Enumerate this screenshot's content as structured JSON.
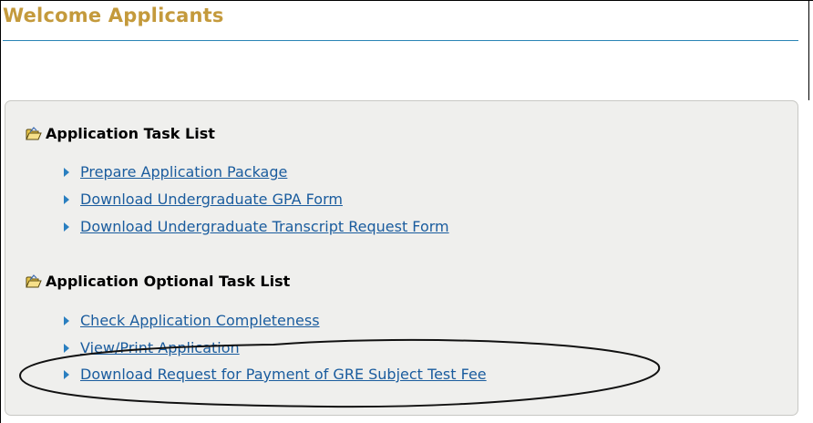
{
  "header": {
    "title": "Welcome Applicants"
  },
  "colors": {
    "title": "#c49a3c",
    "rule": "#2a84b5",
    "link": "#1a5c9e",
    "panel_bg": "#efefed"
  },
  "sections": [
    {
      "heading": "Application Task List",
      "icon": "open-folder-icon",
      "items": [
        {
          "label": "Prepare Application Package",
          "icon": "arrow-right-icon"
        },
        {
          "label": "Download Undergraduate GPA Form",
          "icon": "arrow-right-icon"
        },
        {
          "label": "Download Undergraduate Transcript Request Form",
          "icon": "arrow-right-icon"
        }
      ]
    },
    {
      "heading": "Application Optional Task List",
      "icon": "open-folder-icon",
      "items": [
        {
          "label": "Check Application Completeness",
          "icon": "arrow-right-icon"
        },
        {
          "label": "View/Print Application",
          "icon": "arrow-right-icon"
        },
        {
          "label": "Download Request for Payment of GRE Subject Test Fee",
          "icon": "arrow-right-icon"
        }
      ]
    }
  ]
}
